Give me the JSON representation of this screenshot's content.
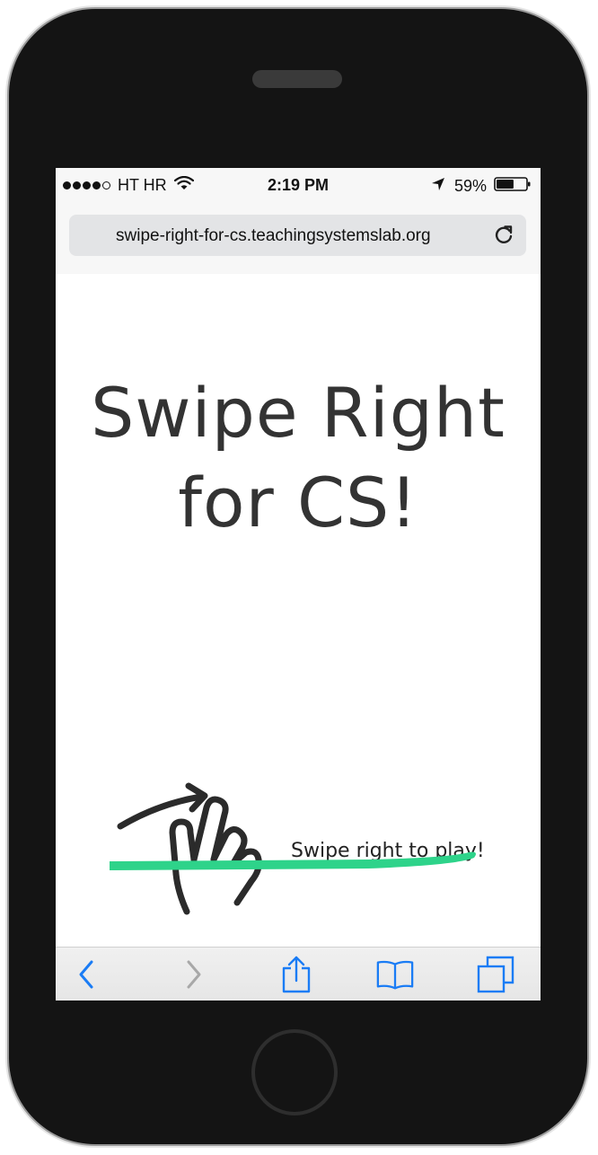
{
  "status_bar": {
    "carrier": "HT HR",
    "time": "2:19 PM",
    "battery_percent": "59%",
    "battery_level": 0.59,
    "signal_bars_filled": 4,
    "signal_bars_total": 5,
    "icons": [
      "wifi-icon",
      "location-arrow-icon",
      "battery-icon"
    ]
  },
  "browser": {
    "url": "swipe-right-for-cs.teachingsystemslab.org",
    "reload_icon": "reload-icon"
  },
  "page": {
    "headline_line1": "Swipe Right",
    "headline_line2": "for CS!",
    "swipe_hint": "Swipe right to play!",
    "gesture_icon": "swipe-hand-icon",
    "stroke_color": "#2ed38a",
    "text_color": "#333333"
  },
  "toolbar": {
    "items": [
      {
        "name": "back-icon",
        "enabled": true
      },
      {
        "name": "forward-icon",
        "enabled": false
      },
      {
        "name": "share-icon",
        "enabled": true
      },
      {
        "name": "bookmarks-icon",
        "enabled": true
      },
      {
        "name": "tabs-icon",
        "enabled": true
      }
    ],
    "accent": "#1a7cf5"
  }
}
